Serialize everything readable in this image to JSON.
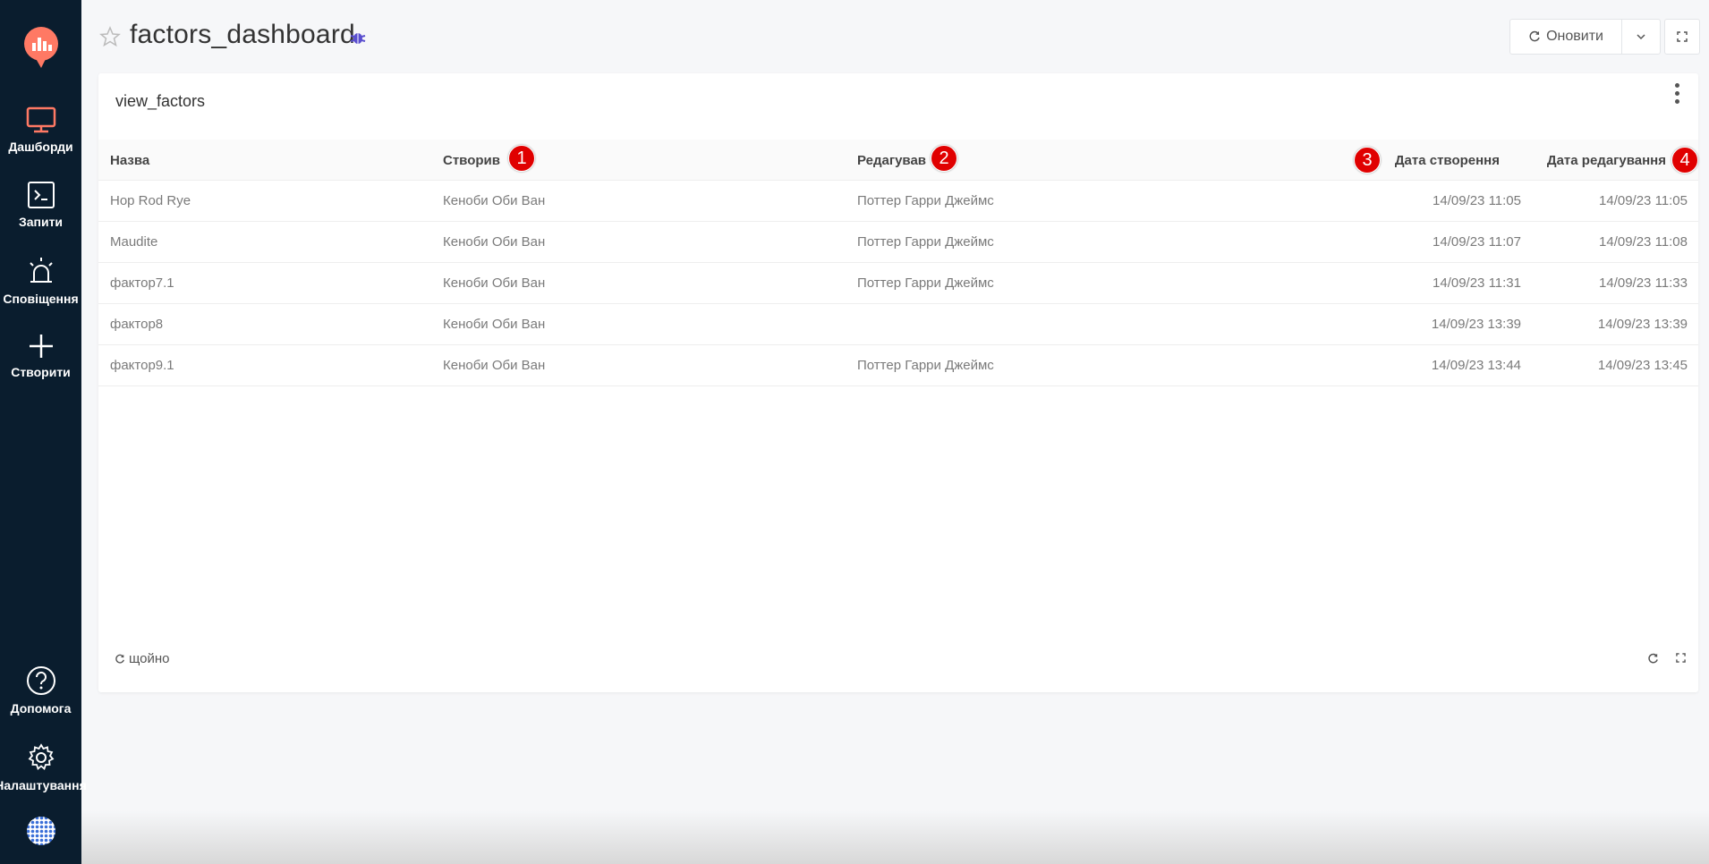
{
  "sidebar": {
    "items": [
      {
        "label": "Дашборди",
        "icon": "monitor-icon",
        "active": true
      },
      {
        "label": "Запити",
        "icon": "terminal-icon"
      },
      {
        "label": "Сповіщення",
        "icon": "alarm-icon"
      },
      {
        "label": "Створити",
        "icon": "plus-icon"
      }
    ],
    "bottom": [
      {
        "label": "Допомога",
        "icon": "help-icon"
      },
      {
        "label": "Налаштування",
        "icon": "gear-icon"
      }
    ]
  },
  "header": {
    "title": "factors_dashboard",
    "refresh_label": "Оновити"
  },
  "widget": {
    "title": "view_factors",
    "columns": [
      "Назва",
      "Створив",
      "Редагував",
      "Дата створення",
      "Дата редагування"
    ],
    "rows": [
      [
        "Hop Rod Rye",
        "Кеноби Оби Ван",
        "Поттер Гарри Джеймс",
        "14/09/23 11:05",
        "14/09/23 11:05"
      ],
      [
        "Maudite",
        "Кеноби Оби Ван",
        "Поттер Гарри Джеймс",
        "14/09/23 11:07",
        "14/09/23 11:08"
      ],
      [
        "фактор7.1",
        "Кеноби Оби Ван",
        "Поттер Гарри Джеймс",
        "14/09/23 11:31",
        "14/09/23 11:33"
      ],
      [
        "фактор8",
        "Кеноби Оби Ван",
        "",
        "14/09/23 13:39",
        "14/09/23 13:39"
      ],
      [
        "фактор9.1",
        "Кеноби Оби Ван",
        "Поттер Гарри Джеймс",
        "14/09/23 13:44",
        "14/09/23 13:45"
      ]
    ],
    "status": "щойно"
  },
  "badges": [
    "1",
    "2",
    "3",
    "4"
  ],
  "colors": {
    "accent": "#ff7964",
    "sidebar": "#0a1d2e",
    "badge": "#e00000"
  }
}
